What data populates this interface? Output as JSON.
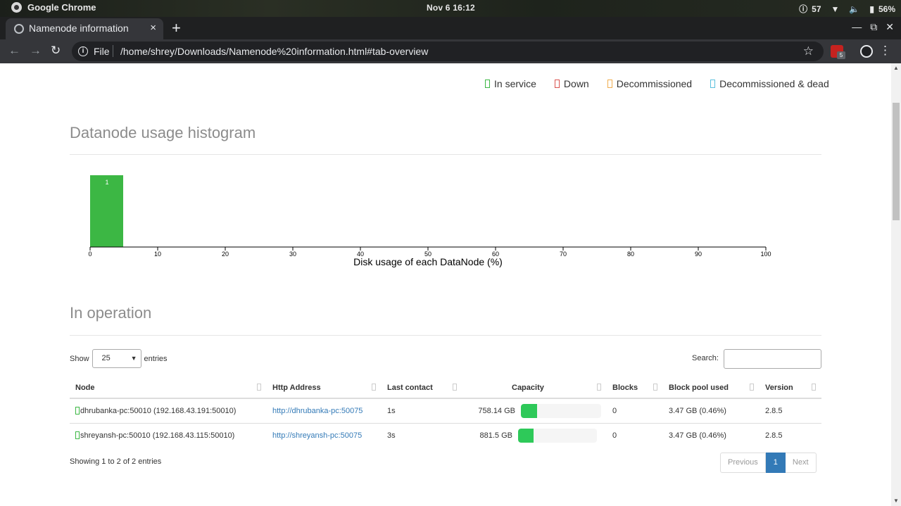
{
  "os": {
    "app_name": "Google Chrome",
    "clock": "Nov 6  16:12",
    "notifications": "57",
    "battery": "56%"
  },
  "browser": {
    "tab_title": "Namenode information",
    "tab_close": "×",
    "new_tab": "+",
    "scheme": "File",
    "url": "/home/shrey/Downloads/Namenode%20information.html#tab-overview",
    "extension_badge": "5"
  },
  "legend": [
    {
      "label": "In service",
      "color": "#3cb744"
    },
    {
      "label": "Down",
      "color": "#d9534f"
    },
    {
      "label": "Decommissioned",
      "color": "#f0ad4e"
    },
    {
      "label": "Decommissioned & dead",
      "color": "#5bc0de"
    }
  ],
  "histogram": {
    "title": "Datanode usage histogram",
    "chart_data": {
      "type": "bar",
      "bins": [
        {
          "from": 0,
          "to": 5,
          "count": 1
        }
      ],
      "x_ticks": [
        "0",
        "10",
        "20",
        "30",
        "40",
        "50",
        "60",
        "70",
        "80",
        "90",
        "100"
      ],
      "xlim": [
        0,
        100
      ],
      "xlabel": "Disk usage of each DataNode (%)",
      "bar_color": "#3cb744"
    }
  },
  "operation": {
    "title": "In operation",
    "show_label": "Show",
    "entries_label": "entries",
    "page_length": "25",
    "search_label": "Search:",
    "columns": [
      "Node",
      "Http Address",
      "Last contact",
      "Capacity",
      "Blocks",
      "Block pool used",
      "Version"
    ],
    "rows": [
      {
        "node": "dhrubanka-pc:50010 (192.168.43.191:50010)",
        "http": "http://dhrubanka-pc:50075",
        "last_contact": "1s",
        "capacity": "758.14 GB",
        "capacity_used_fraction": 0.2,
        "blocks": "0",
        "block_pool_used": "3.47 GB (0.46%)",
        "version": "2.8.5"
      },
      {
        "node": "shreyansh-pc:50010 (192.168.43.115:50010)",
        "http": "http://shreyansh-pc:50075",
        "last_contact": "3s",
        "capacity": "881.5 GB",
        "capacity_used_fraction": 0.2,
        "blocks": "0",
        "block_pool_used": "3.47 GB (0.46%)",
        "version": "2.8.5"
      }
    ],
    "info": "Showing 1 to 2 of 2 entries",
    "pager": {
      "previous": "Previous",
      "current": "1",
      "next": "Next"
    }
  }
}
